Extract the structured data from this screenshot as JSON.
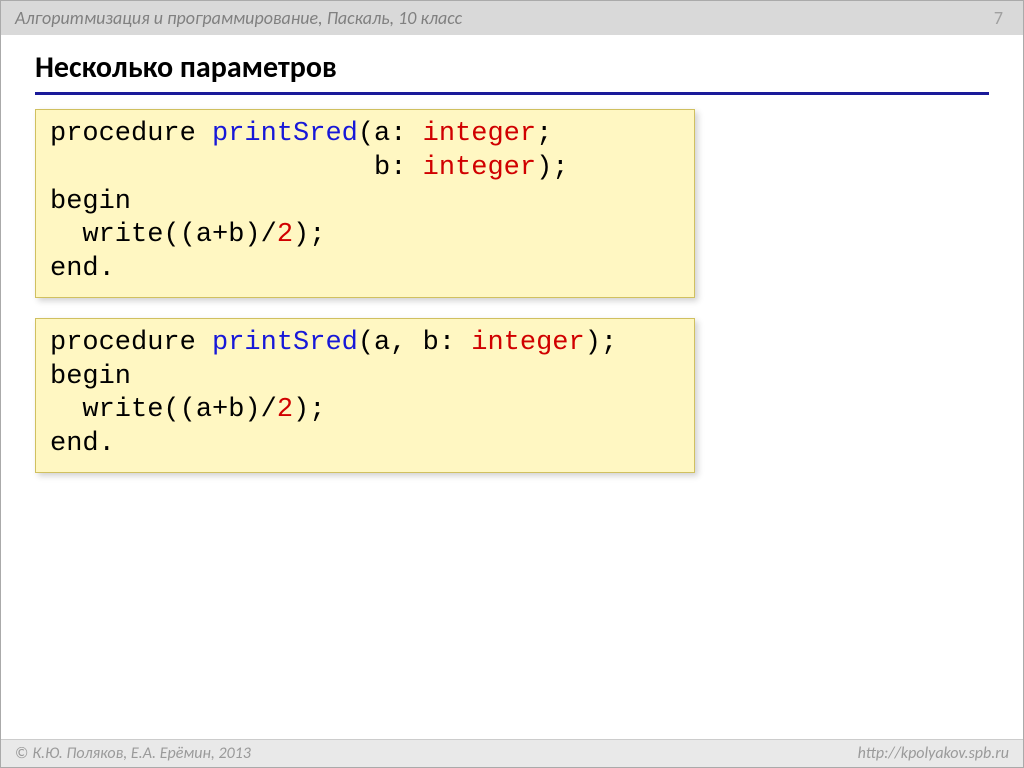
{
  "header": {
    "course": "Алгоритмизация и программирование, Паскаль, 10 класс",
    "page": "7"
  },
  "title": "Несколько параметров",
  "code1": {
    "t1": "procedure",
    "t2": " ",
    "t3": "printSred",
    "t4": "(a: ",
    "t5": "integer",
    "t6": ";",
    "t7": "                    b: ",
    "t8": "integer",
    "t9": ");",
    "t10": "begin",
    "t11": "  write((a+b)/",
    "t12": "2",
    "t13": ");",
    "t14": "end."
  },
  "code2": {
    "t1": "procedure",
    "t2": " ",
    "t3": "printSred",
    "t4": "(a, b: ",
    "t5": "integer",
    "t6": ");",
    "t7": "begin",
    "t8": "  write((a+b)/",
    "t9": "2",
    "t10": ");",
    "t11": "end."
  },
  "footer": {
    "copyright_symbol": "©",
    "authors": "К.Ю. Поляков, Е.А. Ерёмин, 2013",
    "url": "http://kpolyakov.spb.ru"
  }
}
